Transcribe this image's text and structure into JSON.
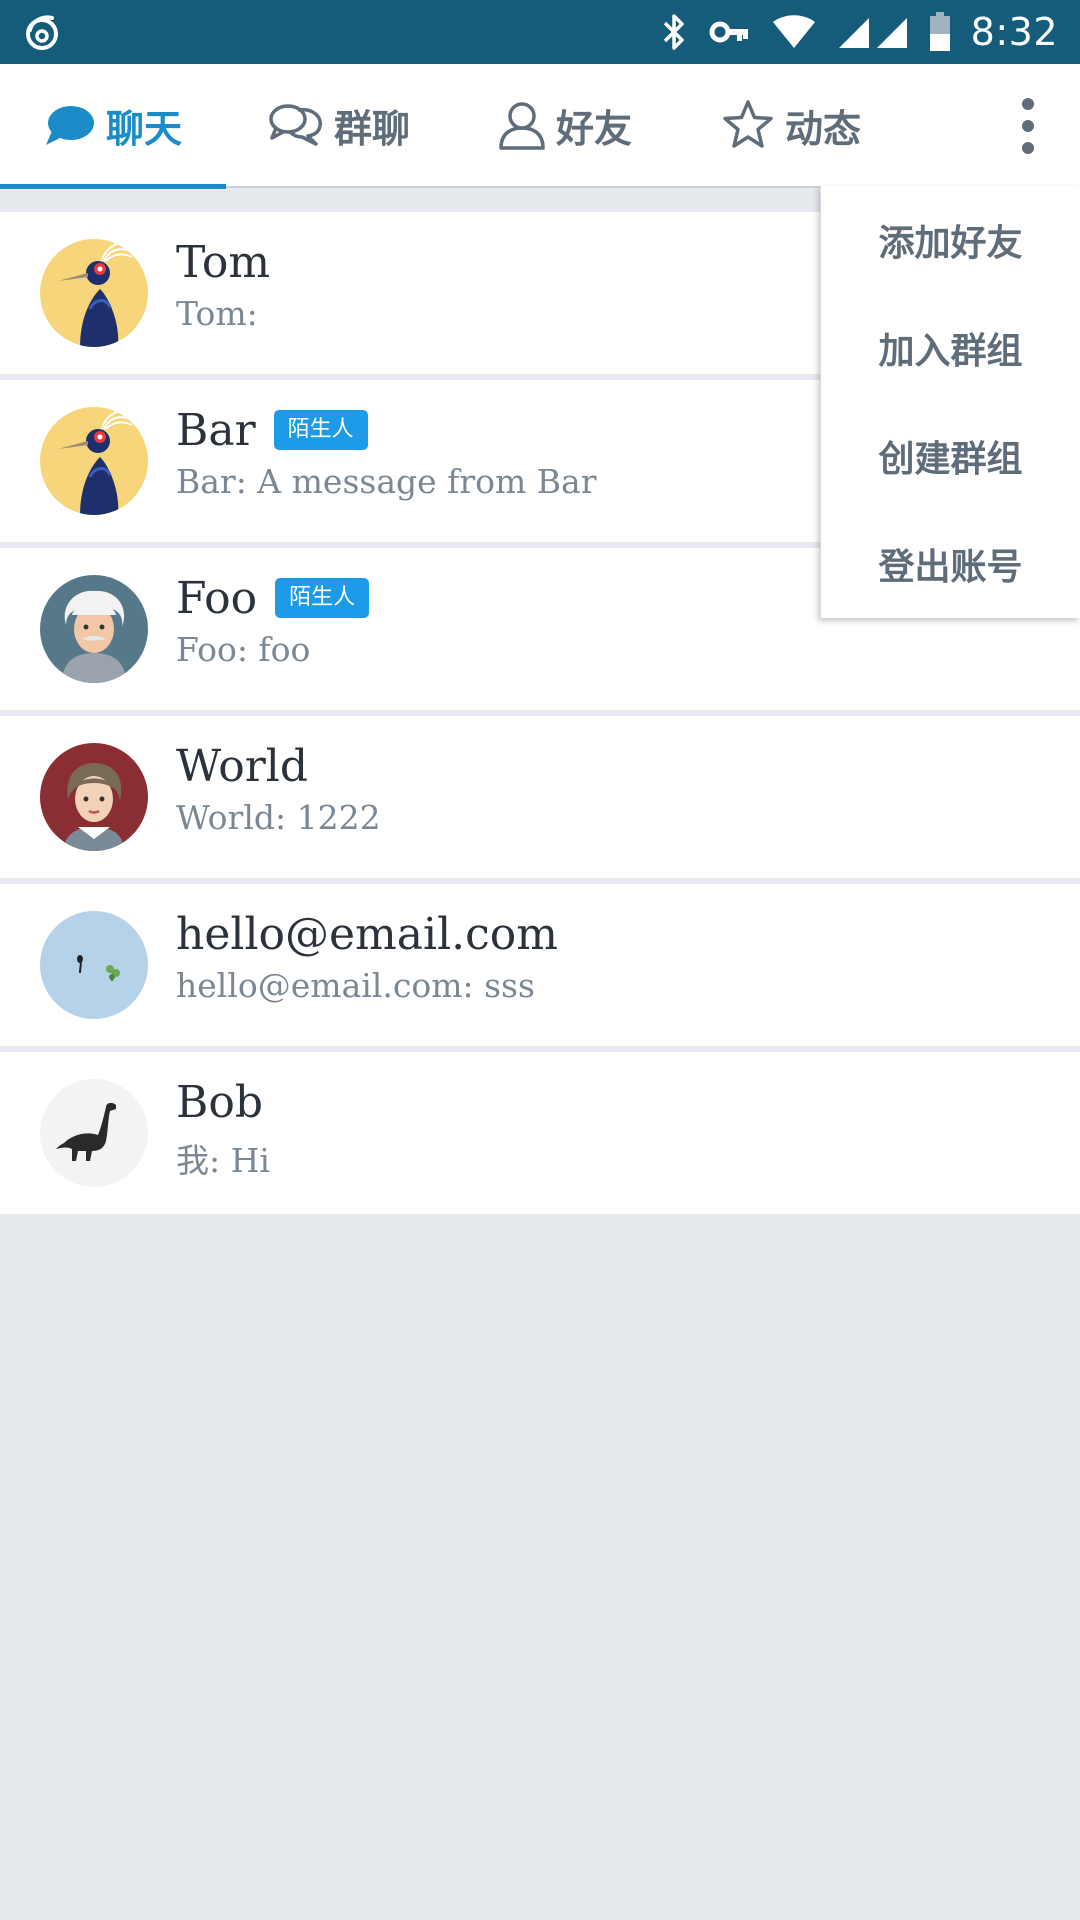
{
  "status_bar": {
    "time": "8:32",
    "icons": [
      "app-logo-icon",
      "bluetooth-icon",
      "vpn-key-icon",
      "wifi-icon",
      "signal-icon",
      "battery-icon"
    ]
  },
  "tabs": [
    {
      "label": "聊天",
      "icon": "chat-bubble-icon",
      "active": true
    },
    {
      "label": "群聊",
      "icon": "group-chat-icon",
      "active": false
    },
    {
      "label": "好友",
      "icon": "person-icon",
      "active": false
    },
    {
      "label": "动态",
      "icon": "star-icon",
      "active": false
    }
  ],
  "menu": {
    "items": [
      "添加好友",
      "加入群组",
      "创建群组",
      "登出账号"
    ]
  },
  "chats": [
    {
      "name": "Tom",
      "preview": "Tom:",
      "badge": "",
      "avatar": "bird-avatar"
    },
    {
      "name": "Bar",
      "preview": "Bar: A message from Bar",
      "badge": "陌生人",
      "avatar": "bird-avatar"
    },
    {
      "name": "Foo",
      "preview": "Foo: foo",
      "badge": "陌生人",
      "avatar": "old-man-avatar"
    },
    {
      "name": "World",
      "preview": "World: 1222",
      "badge": "",
      "avatar": "woman-avatar"
    },
    {
      "name": "hello@email.com",
      "preview": "hello@email.com: sss",
      "badge": "",
      "avatar": "sprout-avatar"
    },
    {
      "name": "Bob",
      "preview": "我: Hi",
      "badge": "",
      "avatar": "dinosaur-avatar"
    }
  ],
  "colors": {
    "status_bar": "#155c7b",
    "accent": "#1b8cc7",
    "badge": "#1d9be8",
    "background": "#e6eaee"
  }
}
